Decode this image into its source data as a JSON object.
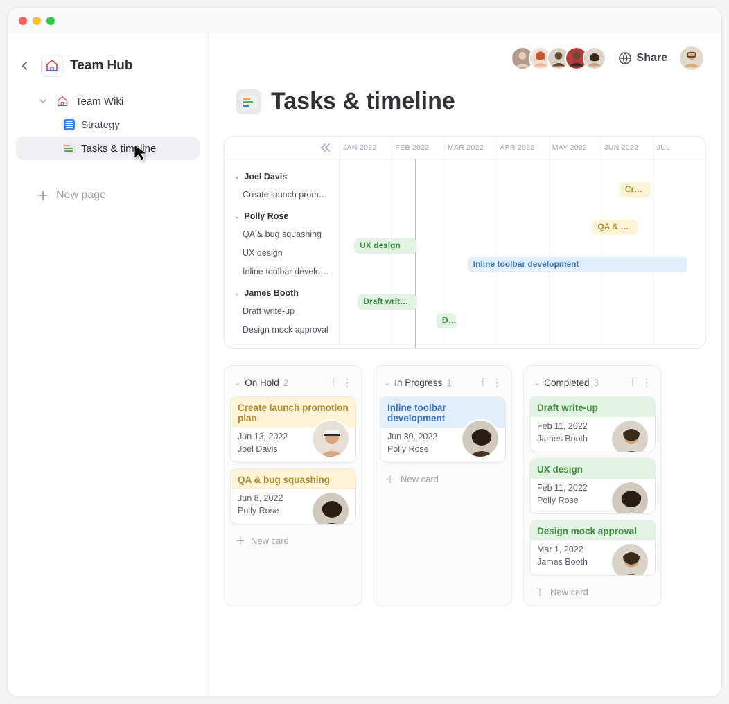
{
  "workspace": {
    "name": "Team Hub"
  },
  "sidebar": {
    "wiki": "Team Wiki",
    "pages": [
      {
        "label": "Strategy"
      },
      {
        "label": "Tasks & timeline"
      }
    ],
    "new_page": "New page"
  },
  "header": {
    "share": "Share"
  },
  "page": {
    "title": "Tasks & timeline"
  },
  "timeline": {
    "months": [
      "JAN 2022",
      "FEB 2022",
      "MAR 2022",
      "APR 2022",
      "MAY 2022",
      "JUN 2022",
      "JUL"
    ],
    "groups": [
      {
        "name": "Joel Davis",
        "tasks": [
          "Create launch promot…"
        ]
      },
      {
        "name": "Polly Rose",
        "tasks": [
          "QA & bug squashing",
          "UX design",
          "Inline toolbar develop…"
        ]
      },
      {
        "name": "James Booth",
        "tasks": [
          "Draft write-up",
          "Design mock approval"
        ]
      }
    ],
    "bars": {
      "create": "Cre…",
      "qa": "QA & bu…",
      "ux": "UX design",
      "inline": "Inline toolbar development",
      "draft": "Draft write-…",
      "design": "D…"
    }
  },
  "kanban": {
    "new_card": "New card",
    "columns": [
      {
        "title": "On Hold",
        "count": "2",
        "cards": [
          {
            "title": "Create launch promotion plan",
            "date": "Jun 13, 2022",
            "person": "Joel Davis",
            "band": "yellow"
          },
          {
            "title": "QA & bug squashing",
            "date": "Jun 8, 2022",
            "person": "Polly Rose",
            "band": "yellow"
          }
        ]
      },
      {
        "title": "In Progress",
        "count": "1",
        "cards": [
          {
            "title": "Inline toolbar development",
            "date": "Jun 30, 2022",
            "person": "Polly Rose",
            "band": "blue"
          }
        ]
      },
      {
        "title": "Completed",
        "count": "3",
        "cards": [
          {
            "title": "Draft write-up",
            "date": "Feb 11, 2022",
            "person": "James Booth",
            "band": "green"
          },
          {
            "title": "UX design",
            "date": "Feb 11, 2022",
            "person": "Polly Rose",
            "band": "green"
          },
          {
            "title": "Design mock approval",
            "date": "Mar 1, 2022",
            "person": "James Booth",
            "band": "green"
          }
        ]
      }
    ]
  },
  "avatar_colors": [
    "#b59a8a",
    "#d07a5a",
    "#5a3f2a",
    "#a23b3b",
    "#6a4a3a"
  ]
}
